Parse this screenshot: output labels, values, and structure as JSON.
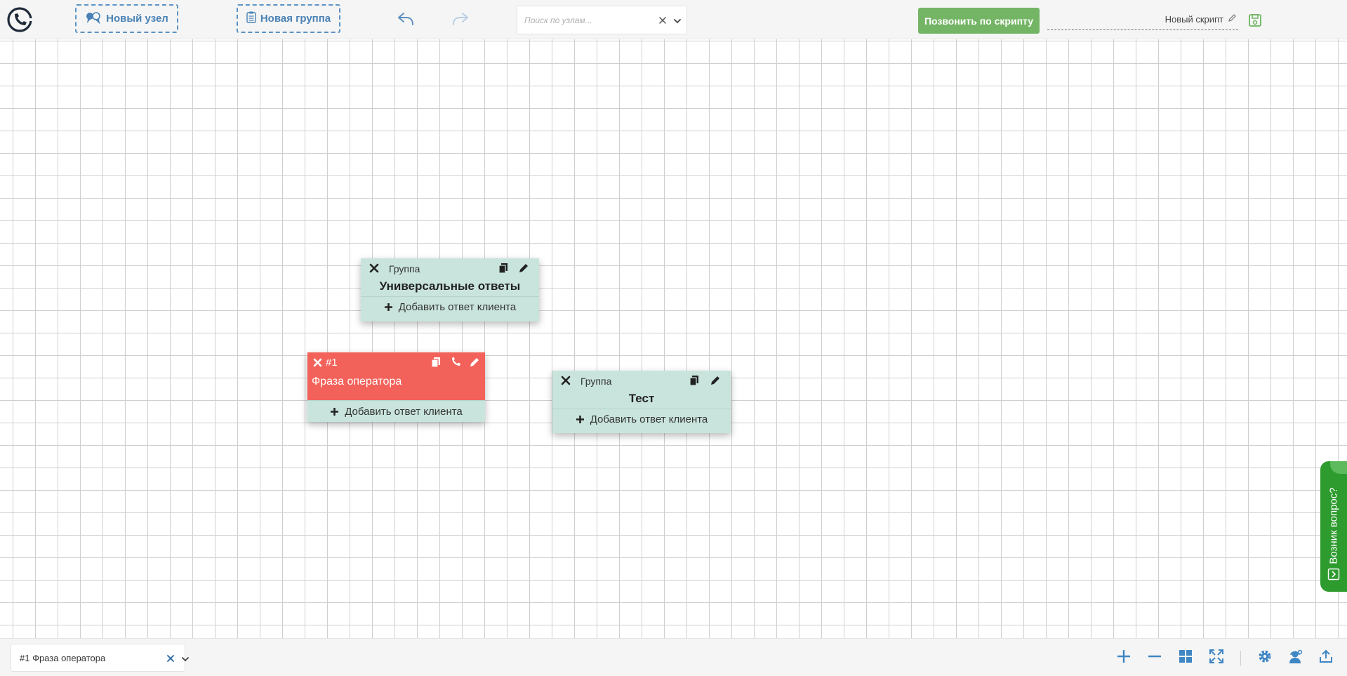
{
  "toolbar": {
    "new_node_label": "Новый узел",
    "new_group_label": "Новая группа",
    "search_placeholder": "Поиск по узлам...",
    "call_script_label": "Позвонить по скрипту",
    "script_name": "Новый скрипт"
  },
  "nodes": {
    "group_universal": {
      "type_label": "Группа",
      "title": "Универсальные ответы",
      "add_answer_label": "Добавить ответ клиента"
    },
    "operator_1": {
      "number": "#1",
      "phrase": "Фраза оператора",
      "add_answer_label": "Добавить ответ клиента"
    },
    "group_test": {
      "type_label": "Группа",
      "title": "Тест",
      "add_answer_label": "Добавить ответ клиента"
    }
  },
  "side_tab": {
    "label": "Возник вопрос?"
  },
  "bottombar": {
    "selected_node": "#1 Фраза оператора"
  },
  "colors": {
    "accent_blue": "#4a82b5",
    "call_green": "#74b565",
    "group_bg": "#c9e4dc",
    "operator_red": "#f3625a",
    "help_tab_green": "#2e9b2e",
    "icon_blue": "#3f86c4"
  },
  "icons": {
    "logo": "phone-in-circle-icon",
    "new_node": "speech-bubbles-icon",
    "new_group": "clipboard-icon",
    "undo": "undo-arrow-icon",
    "redo": "redo-arrow-icon",
    "save": "floppy-disk-icon",
    "zoom_in": "plus-icon",
    "zoom_out": "minus-icon",
    "layout": "grid-icon",
    "fit": "expand-icon",
    "settings": "gear-icon",
    "support": "support-icon",
    "export": "upload-icon"
  }
}
